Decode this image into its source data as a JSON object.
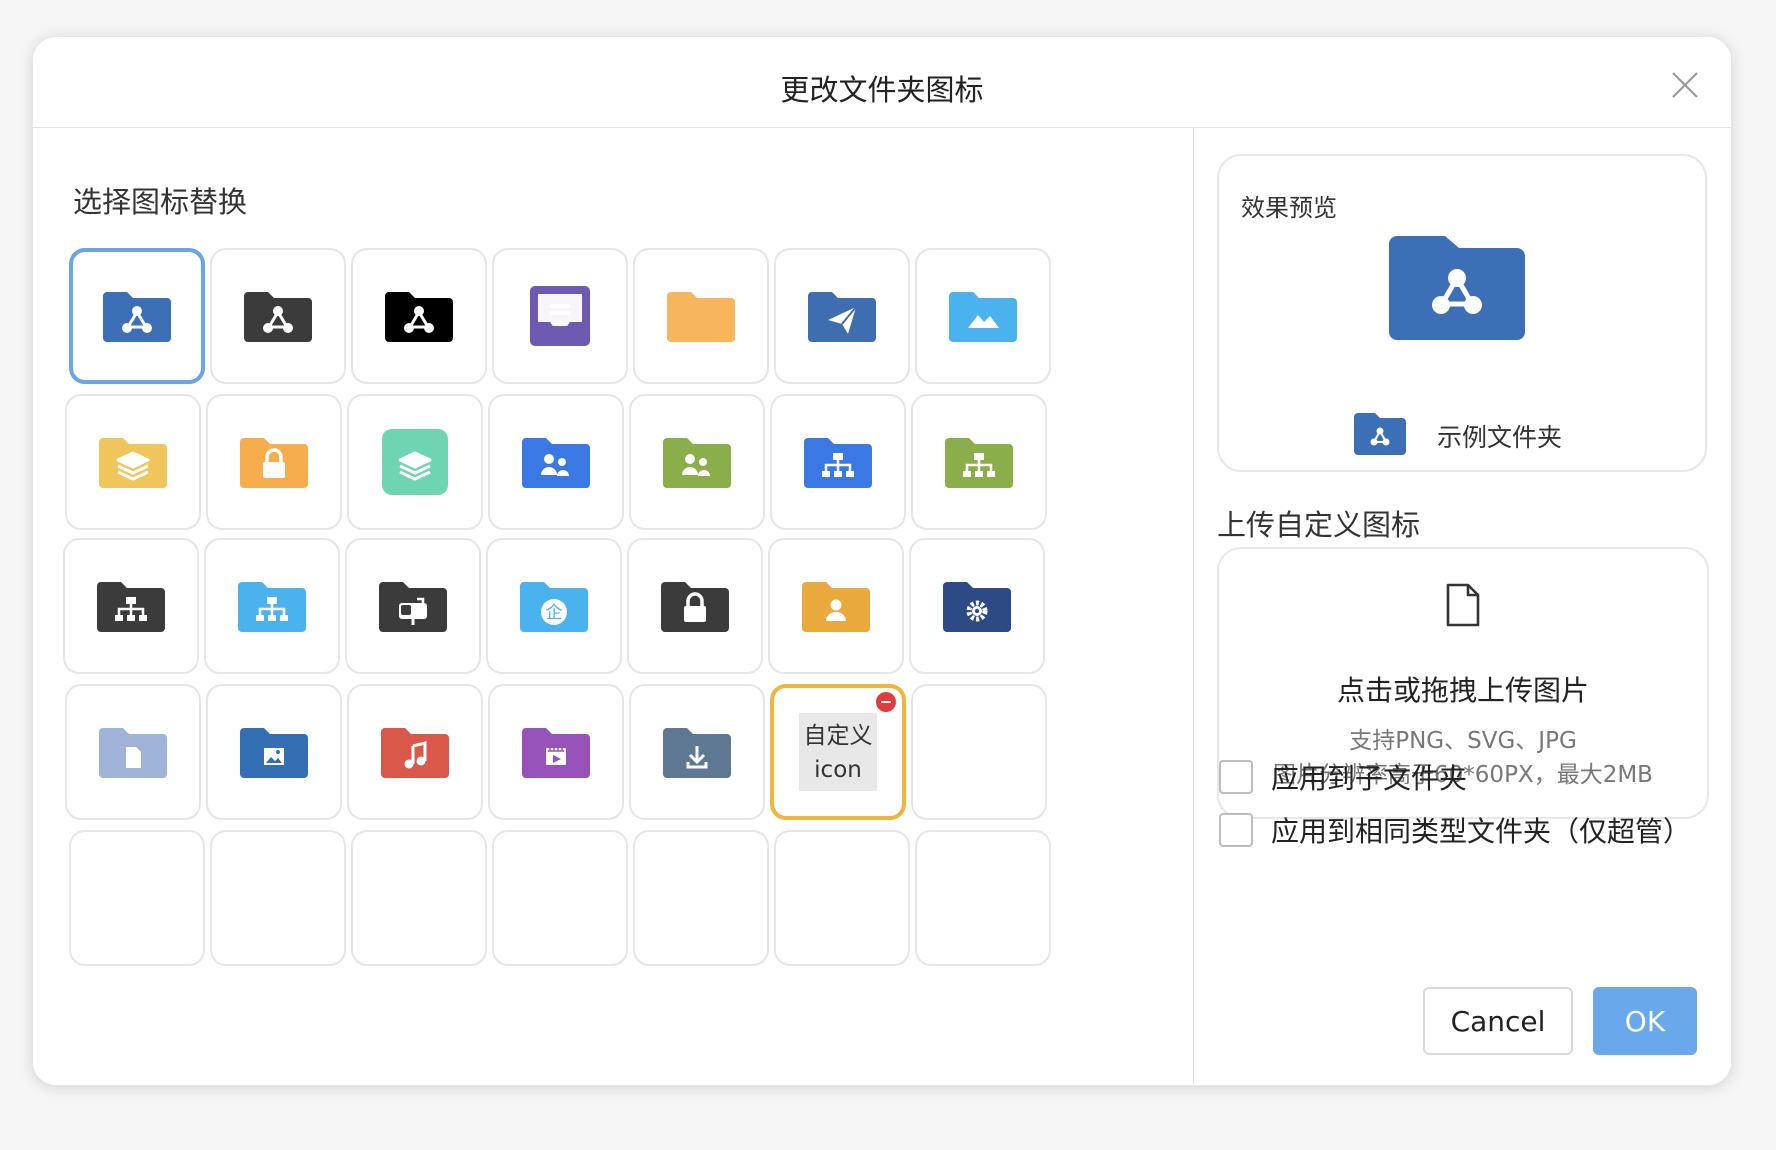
{
  "dialog": {
    "title": "更改文件夹图标",
    "close_icon": "close-icon"
  },
  "left": {
    "section_title": "选择图标替换",
    "icons": [
      {
        "name": "folder-share-blue",
        "bg": "#3c6fb5",
        "glyph": "share",
        "selected": true
      },
      {
        "name": "folder-share-dark",
        "bg": "#3b3b3b",
        "glyph": "share"
      },
      {
        "name": "folder-share-black",
        "bg": "#000000",
        "glyph": "share"
      },
      {
        "name": "inbox-purple",
        "bg": "#6f5ab2",
        "glyph": "inbox"
      },
      {
        "name": "folder-plain-orange",
        "bg": "#f7b55e",
        "glyph": "none"
      },
      {
        "name": "folder-send-blue",
        "bg": "#3f6eb0",
        "glyph": "send"
      },
      {
        "name": "folder-image-lightblue",
        "bg": "#4ab3ee",
        "glyph": "mountain"
      },
      {
        "name": "folder-layers-yellow",
        "bg": "#efc65c",
        "glyph": "layers"
      },
      {
        "name": "folder-lock-orange",
        "bg": "#f6ad4e",
        "glyph": "lock"
      },
      {
        "name": "layers-green",
        "bg": "#6fd4b1",
        "glyph": "layers"
      },
      {
        "name": "folder-users-blue",
        "bg": "#3a78e4",
        "glyph": "users"
      },
      {
        "name": "folder-users-green",
        "bg": "#8aae49",
        "glyph": "users"
      },
      {
        "name": "folder-org-blue",
        "bg": "#3a78e4",
        "glyph": "org"
      },
      {
        "name": "folder-org-green",
        "bg": "#8aae49",
        "glyph": "org"
      },
      {
        "name": "folder-org-dark",
        "bg": "#3b3b3b",
        "glyph": "org"
      },
      {
        "name": "folder-org-lightblue",
        "bg": "#4ab3ee",
        "glyph": "org"
      },
      {
        "name": "folder-mailbox-dark",
        "bg": "#3b3b3b",
        "glyph": "mailbox"
      },
      {
        "name": "folder-enterprise-lightblue",
        "bg": "#4ab3ee",
        "glyph": "enterprise"
      },
      {
        "name": "folder-lock-dark",
        "bg": "#3b3b3b",
        "glyph": "lock"
      },
      {
        "name": "folder-contact-orange",
        "bg": "#e9a93c",
        "glyph": "person"
      },
      {
        "name": "folder-settings-navy",
        "bg": "#2d4a86",
        "glyph": "gear"
      },
      {
        "name": "folder-document-lavender",
        "bg": "#9fb2d8",
        "glyph": "doc"
      },
      {
        "name": "folder-picture-blue",
        "bg": "#356fb3",
        "glyph": "picture"
      },
      {
        "name": "folder-music-red",
        "bg": "#d9584a",
        "glyph": "music"
      },
      {
        "name": "folder-video-purple",
        "bg": "#9652b8",
        "glyph": "video"
      },
      {
        "name": "folder-download-slate",
        "bg": "#5f7892",
        "glyph": "download"
      },
      {
        "name": "custom-icon",
        "custom": true,
        "label": "自定义icon"
      },
      {
        "name": "empty-slot",
        "empty": true
      },
      {
        "name": "empty-slot",
        "empty": true
      },
      {
        "name": "empty-slot",
        "empty": true
      },
      {
        "name": "empty-slot",
        "empty": true
      },
      {
        "name": "empty-slot",
        "empty": true
      },
      {
        "name": "empty-slot",
        "empty": true
      },
      {
        "name": "empty-slot",
        "empty": true
      },
      {
        "name": "empty-slot",
        "empty": true
      }
    ]
  },
  "preview": {
    "label": "效果预览",
    "folder_name": "示例文件夹",
    "folder_color": "#3c6fb5"
  },
  "upload": {
    "title": "上传自定义图标",
    "main_text": "点击或拖拽上传图片",
    "hint_formats": "支持PNG、SVG、JPG",
    "hint_size": "图片分辨率高于60*60PX，最大2MB"
  },
  "options": {
    "apply_subfolders": "应用到子文件夹",
    "apply_same_type": "应用到相同类型文件夹（仅超管）"
  },
  "buttons": {
    "cancel": "Cancel",
    "ok": "OK"
  }
}
